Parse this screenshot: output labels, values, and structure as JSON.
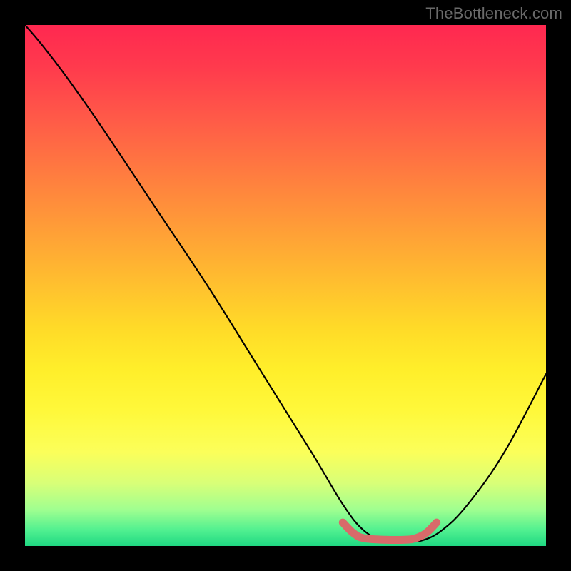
{
  "attribution": "TheBottleneck.com",
  "chart_data": {
    "type": "line",
    "title": "",
    "xlabel": "",
    "ylabel": "",
    "xlim": [
      0,
      100
    ],
    "ylim": [
      0,
      100
    ],
    "grid": false,
    "legend": false,
    "series": [
      {
        "name": "bottleneck-curve",
        "x": [
          0,
          3,
          8,
          15,
          25,
          35,
          45,
          55,
          61,
          65,
          69,
          73,
          76,
          80,
          85,
          92,
          100
        ],
        "y": [
          100,
          96.5,
          90,
          80,
          65,
          50,
          34,
          18,
          8,
          3,
          1,
          1,
          1,
          3,
          8,
          18,
          33
        ],
        "color": "#000"
      },
      {
        "name": "optimal-range-marker",
        "x": [
          61,
          63,
          65,
          69,
          73,
          75,
          77,
          79
        ],
        "y": [
          4.5,
          2.5,
          1.5,
          1.2,
          1.2,
          1.5,
          2.5,
          4.5
        ],
        "color": "#d86a6a"
      }
    ],
    "background_gradient": {
      "top": "#ff2850",
      "mid": "#ffee2a",
      "bottom": "#1fd882"
    }
  }
}
